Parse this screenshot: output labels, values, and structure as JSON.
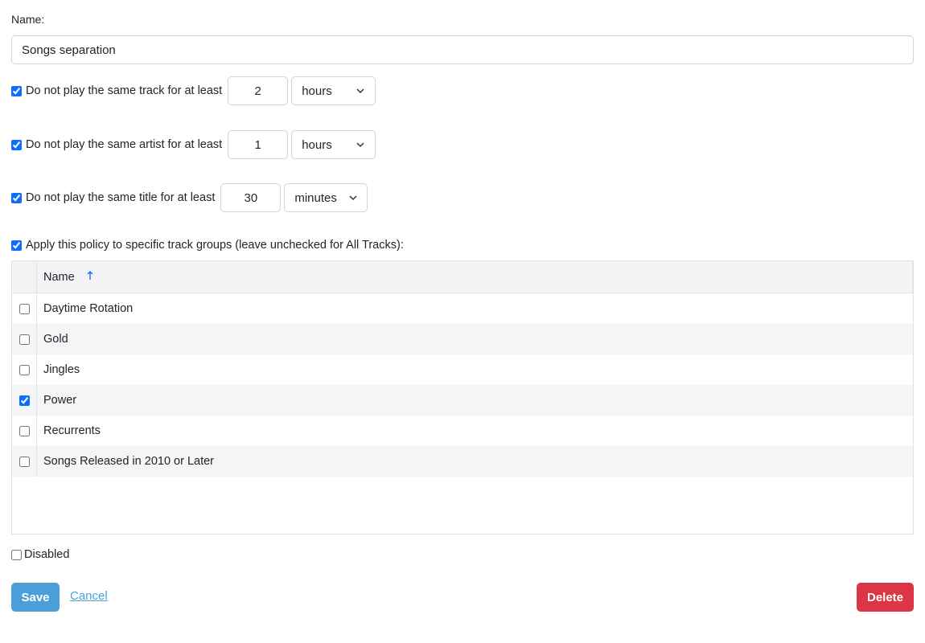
{
  "form": {
    "name_label": "Name:",
    "name_value": "Songs separation"
  },
  "rules": [
    {
      "label": "Do not play the same track for at least",
      "checked": true,
      "value": "2",
      "unit": "hours"
    },
    {
      "label": "Do not play the same artist for at least",
      "checked": true,
      "value": "1",
      "unit": "hours"
    },
    {
      "label": "Do not play the same title for at least",
      "checked": true,
      "value": "30",
      "unit": "minutes"
    }
  ],
  "apply": {
    "label": "Apply this policy to specific track groups (leave unchecked for All Tracks):",
    "checked": true
  },
  "grid": {
    "header_name": "Name",
    "sort_icon": "arrow-up-icon",
    "rows": [
      {
        "name": "Daytime Rotation",
        "checked": false
      },
      {
        "name": "Gold",
        "checked": false
      },
      {
        "name": "Jingles",
        "checked": false
      },
      {
        "name": "Power",
        "checked": true
      },
      {
        "name": "Recurrents",
        "checked": false
      },
      {
        "name": "Songs Released in 2010 or Later",
        "checked": false
      }
    ]
  },
  "disabled": {
    "label": "Disabled",
    "checked": false
  },
  "actions": {
    "save_label": "Save",
    "cancel_label": "Cancel",
    "delete_label": "Delete"
  },
  "colors": {
    "save": "#4a9fd8",
    "delete": "#dc3545",
    "accent": "#0d6efd"
  }
}
